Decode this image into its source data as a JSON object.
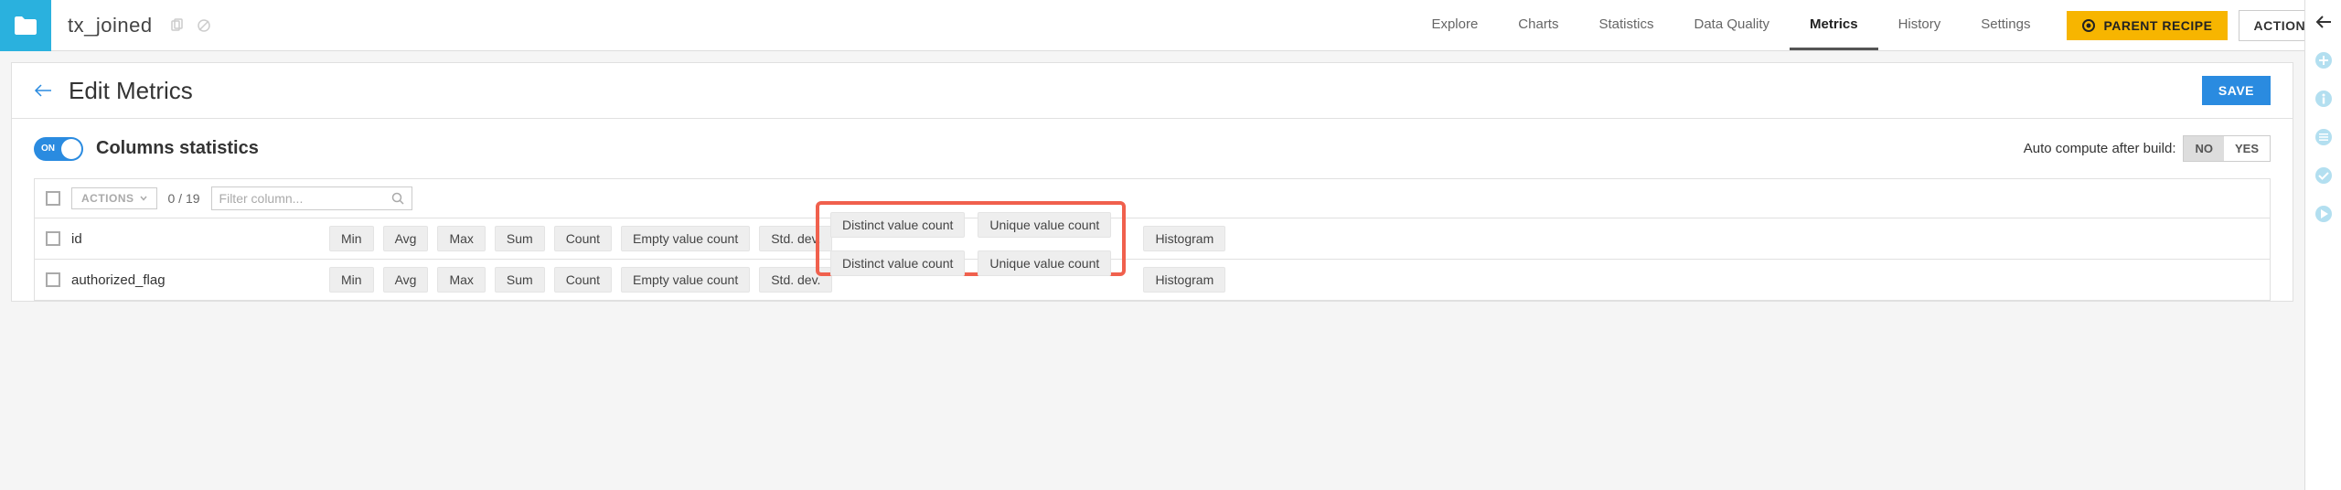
{
  "header": {
    "dataset_name": "tx_joined",
    "tabs": [
      "Explore",
      "Charts",
      "Statistics",
      "Data Quality",
      "Metrics",
      "History",
      "Settings"
    ],
    "active_tab": "Metrics",
    "parent_recipe_label": "PARENT RECIPE",
    "actions_label": "ACTIONS"
  },
  "edit_bar": {
    "title": "Edit Metrics",
    "save_label": "SAVE"
  },
  "section": {
    "toggle_state": "ON",
    "title": "Columns statistics",
    "auto_compute_label": "Auto compute after build:",
    "no_label": "NO",
    "yes_label": "YES",
    "selected_yn": "NO"
  },
  "table": {
    "actions_dd_label": "ACTIONS",
    "counter": "0 / 19",
    "filter_placeholder": "Filter column...",
    "stat_labels": [
      "Min",
      "Avg",
      "Max",
      "Sum",
      "Count",
      "Empty value count",
      "Std. dev.",
      "Distinct value count",
      "Unique value count",
      "Histogram"
    ],
    "rows": [
      {
        "name": "id"
      },
      {
        "name": "authorized_flag"
      }
    ]
  }
}
